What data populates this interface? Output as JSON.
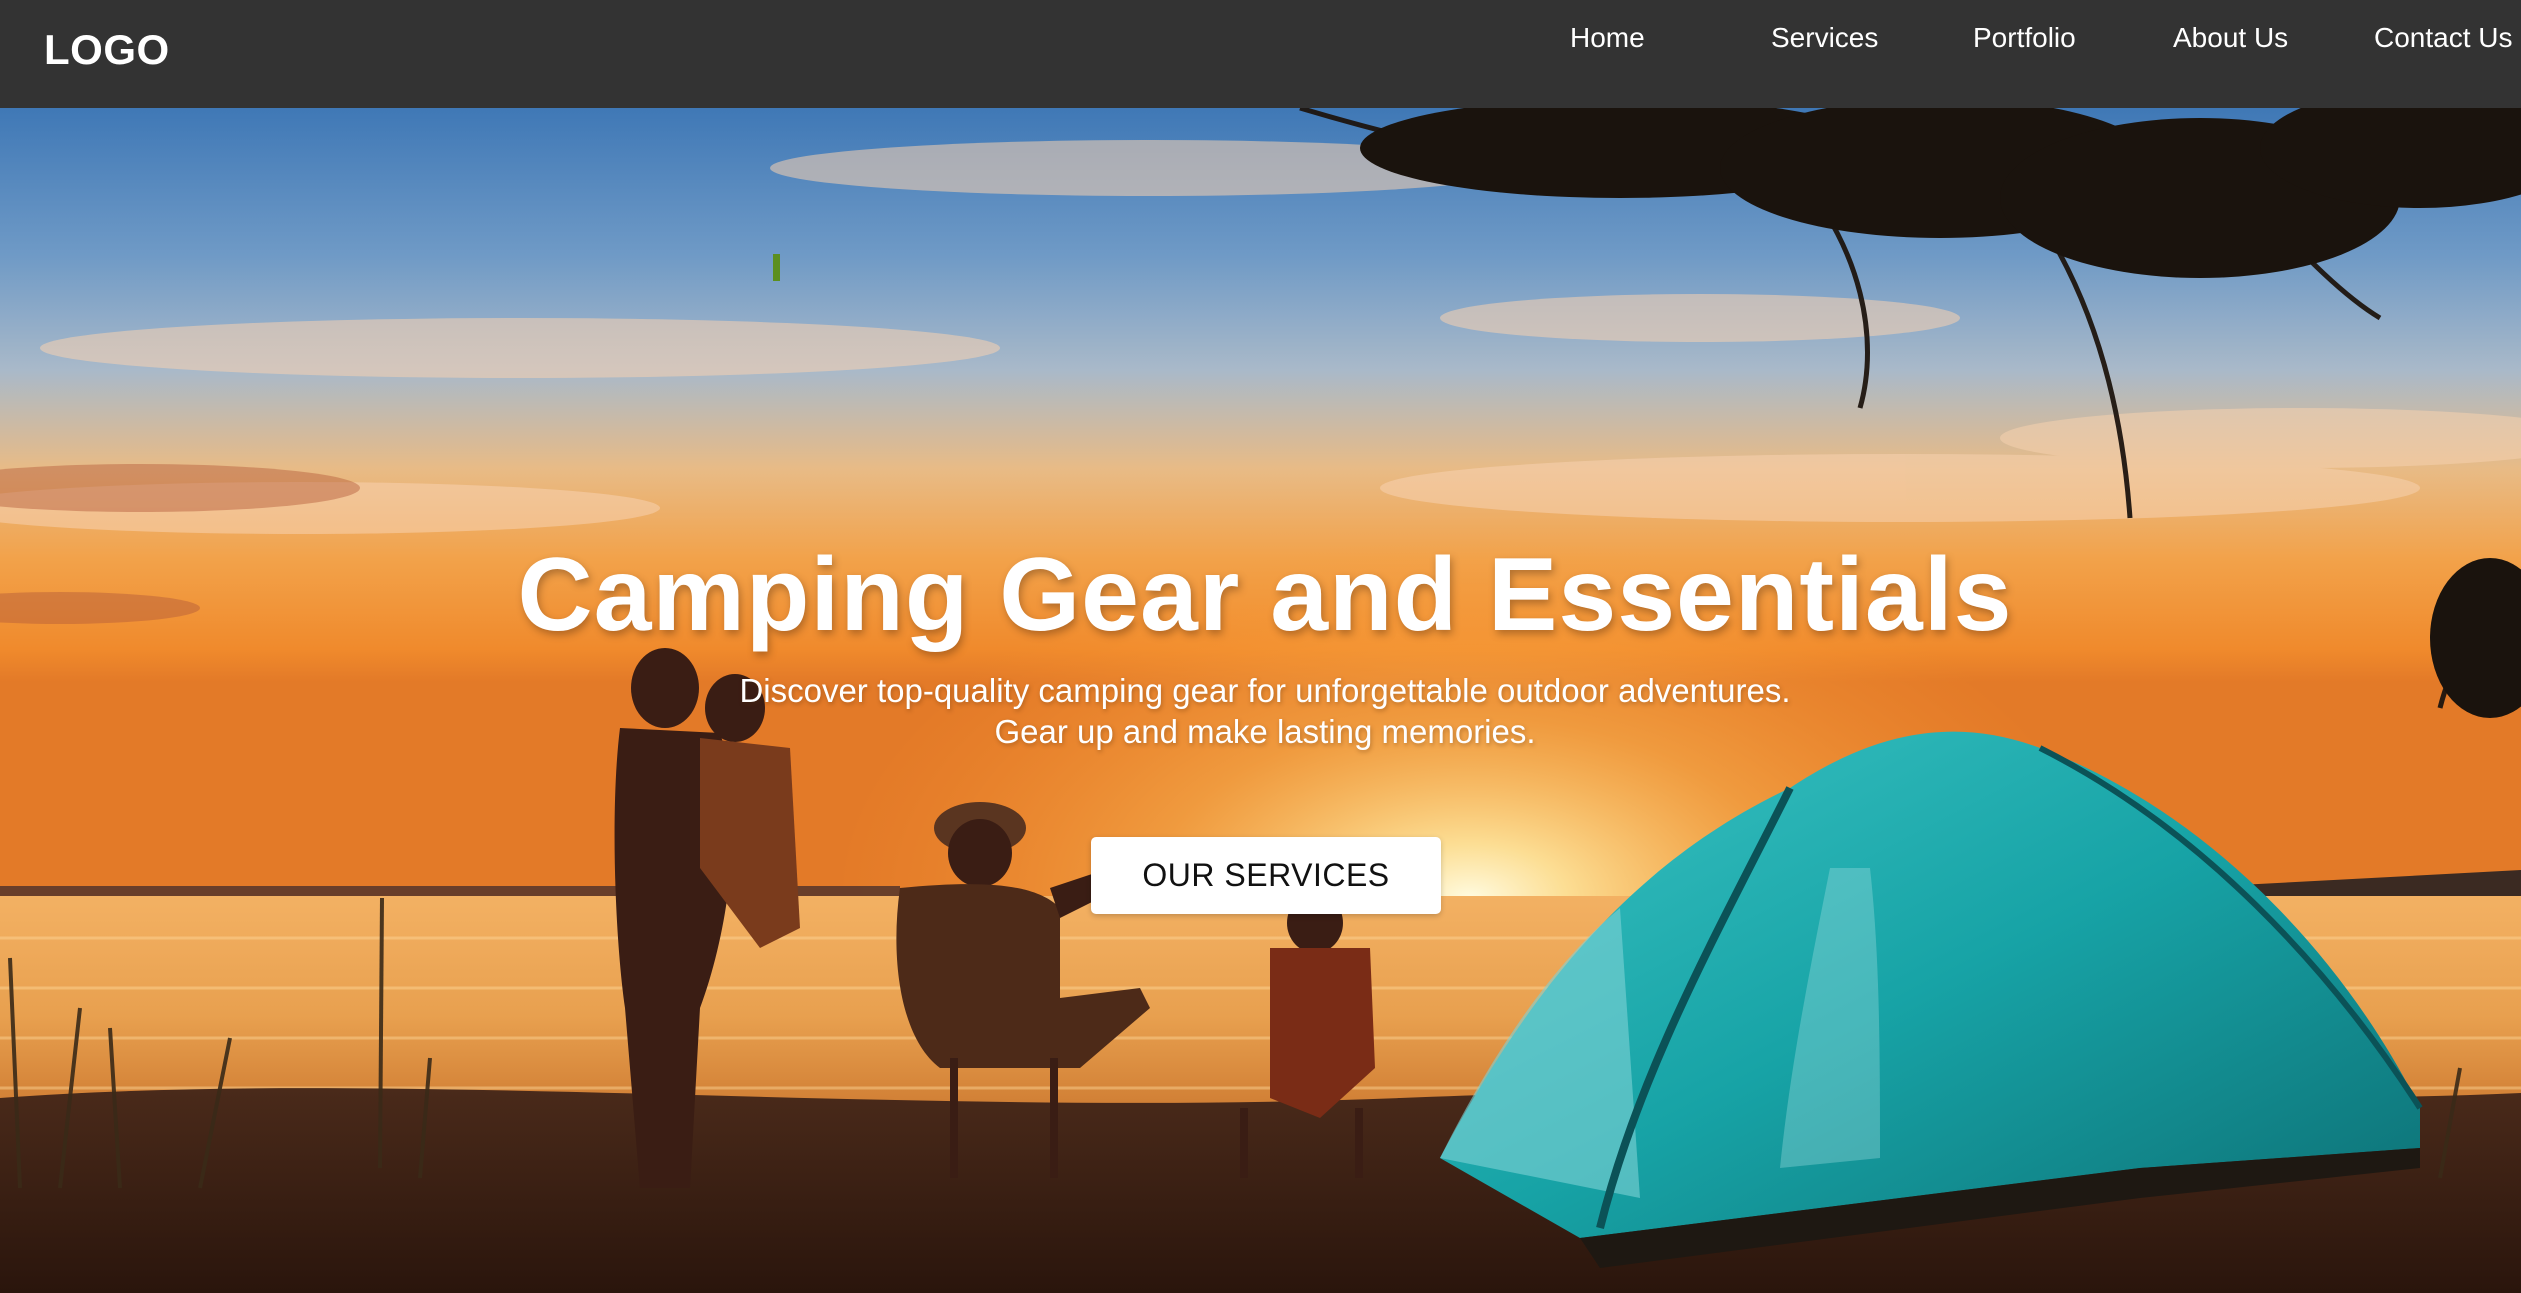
{
  "header": {
    "logo": "LOGO",
    "nav": [
      {
        "label": "Home"
      },
      {
        "label": "Services"
      },
      {
        "label": "Portfolio"
      },
      {
        "label": "About Us"
      },
      {
        "label": "Contact Us"
      }
    ]
  },
  "hero": {
    "title": "Camping Gear and Essentials",
    "subtitle_line1": "Discover top-quality camping gear for unforgettable outdoor adventures.",
    "subtitle_line2": "Gear up and make lasting memories.",
    "cta_label": "OUR SERVICES",
    "background_image": "sunset-lake-family-camping-tent"
  },
  "colors": {
    "nav_bg": "#333333",
    "nav_text": "#ffffff",
    "button_bg": "#ffffff",
    "tent": "#1aa3a8"
  }
}
